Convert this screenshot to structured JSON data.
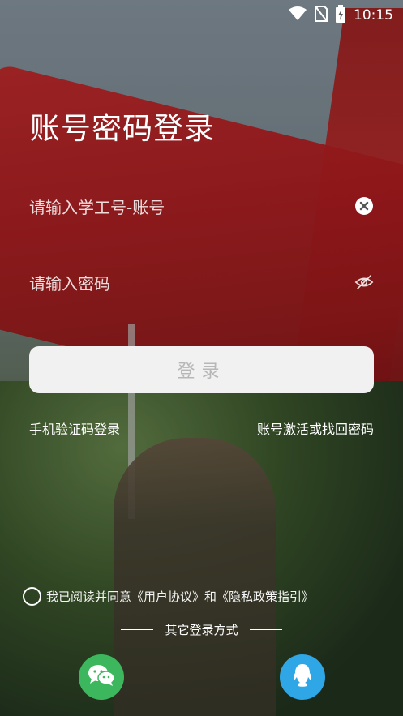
{
  "status_bar": {
    "time": "10:15",
    "icons": [
      "wifi-icon",
      "no-sim-icon",
      "battery-charging-icon"
    ]
  },
  "page": {
    "title": "账号密码登录"
  },
  "form": {
    "account_placeholder": "请输入学工号-账号",
    "password_placeholder": "请输入密码",
    "login_label": "登录"
  },
  "links": {
    "sms_login": "手机验证码登录",
    "activate_recover": "账号激活或找回密码"
  },
  "agreement": {
    "prefix": "我已阅读并同意",
    "user_agreement": "《用户协议》",
    "and": "和",
    "privacy_policy": "《隐私政策指引》"
  },
  "other_login": {
    "label": "其它登录方式",
    "options": [
      "wechat-icon",
      "qq-icon"
    ]
  },
  "colors": {
    "wechat": "#3db75d",
    "qq": "#2fa7e6",
    "button_bg": "#f1f1f1",
    "button_text": "#b7b7b7"
  }
}
